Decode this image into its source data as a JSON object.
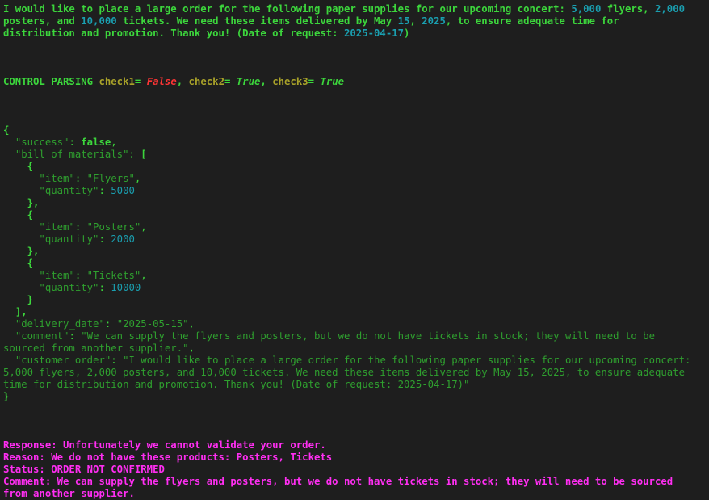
{
  "request": {
    "p1": "I would like to place a large order for the following paper supplies for our upcoming concert: ",
    "n1": "5,000",
    "p2": " flyers, ",
    "n2": "2,000",
    "p3": "\nposters, and ",
    "n3": "10,000",
    "p4": " tickets. We need these items delivered by May ",
    "n4": "15",
    "p5": ", ",
    "n5": "2025",
    "p6": ", to ensure adequate time for\ndistribution and promotion. Thank you! (Date of request: ",
    "n6": "2025-04-17",
    "p7": ")"
  },
  "control": {
    "label": "CONTROL PARSING ",
    "check1_name": "check1",
    "check1_value": "False",
    "check2_name": "check2",
    "check2_value": "True",
    "check3_name": "check3",
    "check3_value": "True"
  },
  "json": {
    "open": "{",
    "success_key": "\"success\"",
    "success_val": "false",
    "bom_key": "\"bill of materials\"",
    "items": [
      {
        "item_key": "\"item\"",
        "item_val": "\"Flyers\"",
        "qty_key": "\"quantity\"",
        "qty_val": "5000"
      },
      {
        "item_key": "\"item\"",
        "item_val": "\"Posters\"",
        "qty_key": "\"quantity\"",
        "qty_val": "2000"
      },
      {
        "item_key": "\"item\"",
        "item_val": "\"Tickets\"",
        "qty_key": "\"quantity\"",
        "qty_val": "10000"
      }
    ],
    "delivery_key": "\"delivery_date\"",
    "delivery_val": "\"2025-05-15\"",
    "comment_key": "\"comment\"",
    "comment_val": "\"We can supply the flyers and posters, but we do not have tickets in stock; they will need to be\nsourced from another supplier.\"",
    "customer_key": "\"customer order\"",
    "customer_val": "\"I would like to place a large order for the following paper supplies for our upcoming concert:\n5,000 flyers, 2,000 posters, and 10,000 tickets. We need these items delivered by May 15, 2025, to ensure adequate\ntime for distribution and promotion. Thank you! (Date of request: 2025-04-17)\"",
    "close": "}"
  },
  "response": {
    "response": "Response: Unfortunately we cannot validate your order.",
    "reason": "Reason: We do not have these products: Posters, Tickets",
    "status": "Status: ORDER NOT CONFIRMED",
    "comment": "Comment: We can supply the flyers and posters, but we do not have tickets in stock; they will need to be sourced\nfrom another supplier."
  },
  "colors": {
    "background": "#1e1e1e",
    "green": "#3cd63c",
    "dark_green": "#2fa02f",
    "number_cyan": "#1a9fb0",
    "olive": "#a9a229",
    "red": "#ff3535",
    "magenta": "#ff2ef2"
  }
}
